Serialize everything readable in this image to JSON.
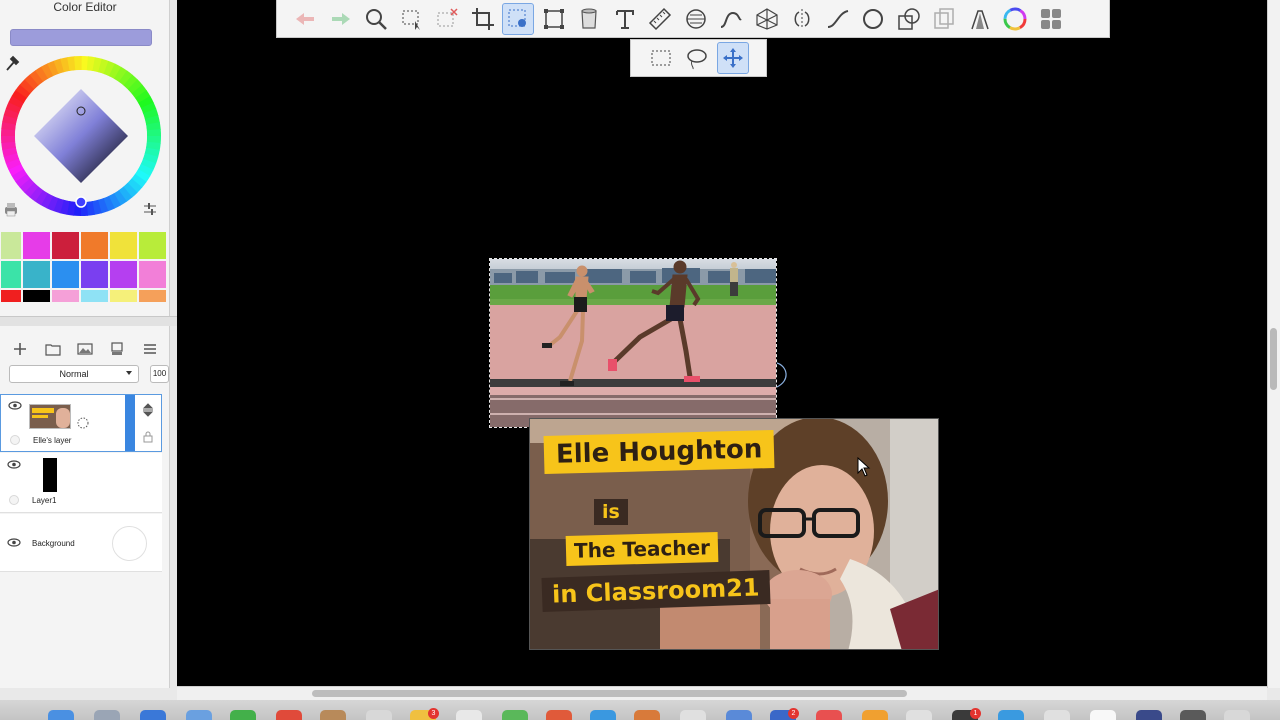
{
  "color_editor": {
    "title": "Color Editor",
    "current_color": "#9c9cdb",
    "palette": [
      [
        "#c9e89a",
        "#e63ce8",
        "#cc1f3c",
        "#f07a2a",
        "#f0e23a",
        "#b8ec3a"
      ],
      [
        "#3be3a8",
        "#39b3c9",
        "#2b8ff0",
        "#7a3ff0",
        "#b53ff0",
        "#f27fd8"
      ],
      [
        "#f01f1f",
        "#000000",
        "#f5a0d8",
        "#8fe2f5",
        "#f5f07a",
        "#f5a05a"
      ]
    ]
  },
  "layers": {
    "blend_mode": "Normal",
    "opacity": "100",
    "items": [
      {
        "name": "Elle's layer",
        "selected": true,
        "thumb_text": "Elle Houghton"
      },
      {
        "name": "Layer1",
        "selected": false
      },
      {
        "name": "Background",
        "selected": false
      }
    ]
  },
  "toolbar": {
    "tools": [
      "undo-icon",
      "redo-icon",
      "zoom-icon",
      "select-move-icon",
      "select-clear-icon",
      "crop-icon",
      "lasso-select-icon",
      "transform-icon",
      "fill-icon",
      "text-icon",
      "ruler-icon",
      "symmetry-icon",
      "stroke-icon",
      "perspective-icon",
      "mirror-icon",
      "curve-icon",
      "ellipse-icon",
      "shapes-icon",
      "copy-icon",
      "brush-icon",
      "color-wheel-icon",
      "layers-grid-icon"
    ],
    "active_tool": "lasso-select-icon",
    "subtools": [
      "rect-select-icon",
      "lasso-icon",
      "move-icon"
    ],
    "active_subtool": "move-icon"
  },
  "canvas": {
    "caption_1": "Elle Houghton",
    "caption_2": "is",
    "caption_3": "The Teacher",
    "caption_4": "in Classroom21"
  },
  "dock": {
    "badges": [
      "3",
      "2",
      "1"
    ]
  }
}
